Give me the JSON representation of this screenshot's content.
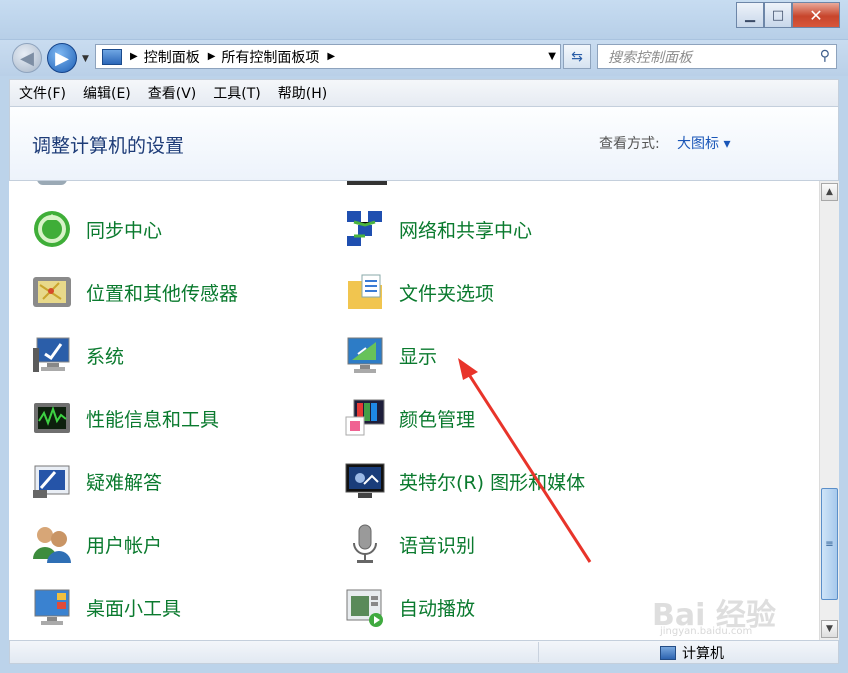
{
  "window": {
    "minimize": "▁",
    "maximize": "□",
    "close": "✕"
  },
  "address": {
    "segments": [
      "控制面板",
      "所有控制面板项"
    ],
    "separator": "▶"
  },
  "search": {
    "placeholder": "搜索控制面板"
  },
  "menu": [
    "文件(F)",
    "编辑(E)",
    "查看(V)",
    "工具(T)",
    "帮助(H)"
  ],
  "header": {
    "title": "调整计算机的设置",
    "view_label": "查看方式:",
    "view_value": "大图标 ▾"
  },
  "items": [
    {
      "label": "同步中心",
      "icon": "sync-center-icon"
    },
    {
      "label": "网络和共享中心",
      "icon": "network-icon"
    },
    {
      "label": "位置和其他传感器",
      "icon": "location-sensor-icon"
    },
    {
      "label": "文件夹选项",
      "icon": "folder-options-icon"
    },
    {
      "label": "系统",
      "icon": "system-icon"
    },
    {
      "label": "显示",
      "icon": "display-icon"
    },
    {
      "label": "性能信息和工具",
      "icon": "performance-icon"
    },
    {
      "label": "颜色管理",
      "icon": "color-management-icon"
    },
    {
      "label": "疑难解答",
      "icon": "troubleshooting-icon"
    },
    {
      "label": "英特尔(R) 图形和媒体",
      "icon": "intel-graphics-icon"
    },
    {
      "label": "用户帐户",
      "icon": "user-accounts-icon"
    },
    {
      "label": "语音识别",
      "icon": "speech-recognition-icon"
    },
    {
      "label": "桌面小工具",
      "icon": "desktop-gadgets-icon"
    },
    {
      "label": "自动播放",
      "icon": "autoplay-icon"
    }
  ],
  "status": {
    "location": "计算机"
  },
  "watermark": {
    "text": "Bai 经验",
    "url": "jingyan.baidu.com"
  },
  "colors": {
    "link_green": "#0a7a2e",
    "title_blue": "#1e3c78",
    "annotation_red": "#e8342a"
  }
}
